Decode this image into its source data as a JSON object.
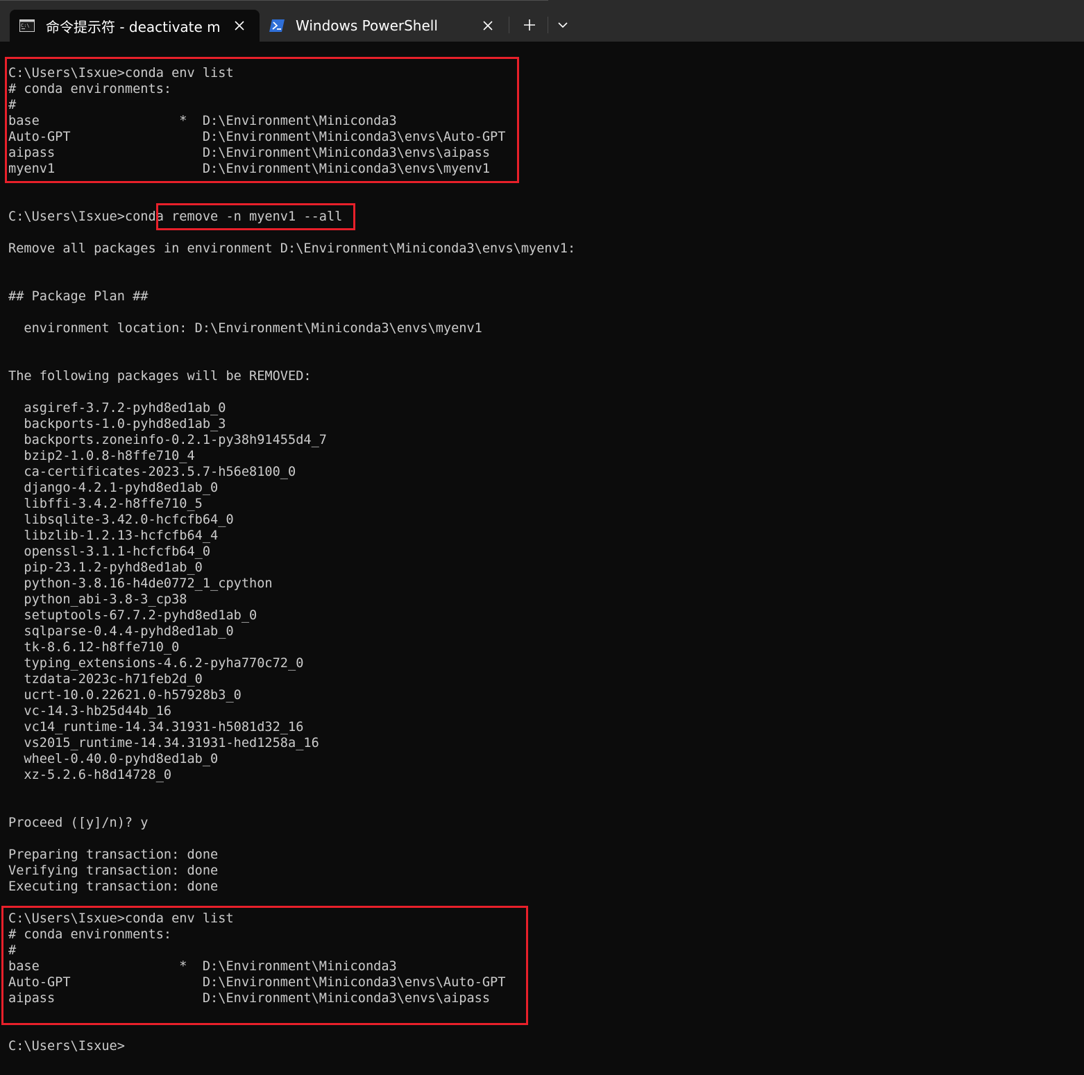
{
  "tabs": [
    {
      "label": "命令提示符 - deactivate  m",
      "icon": "cmd-icon",
      "active": true
    },
    {
      "label": "Windows PowerShell",
      "icon": "powershell-icon",
      "active": false
    }
  ],
  "tabbar": {
    "new_tab": "+",
    "dropdown": "chevron-down"
  },
  "terminal": {
    "lines": [
      "C:\\Users\\Isxue>conda env list",
      "# conda environments:",
      "#",
      "base                  *  D:\\Environment\\Miniconda3",
      "Auto-GPT                 D:\\Environment\\Miniconda3\\envs\\Auto-GPT",
      "aipass                   D:\\Environment\\Miniconda3\\envs\\aipass",
      "myenv1                   D:\\Environment\\Miniconda3\\envs\\myenv1",
      "",
      "",
      "C:\\Users\\Isxue>conda remove -n myenv1 --all",
      "",
      "Remove all packages in environment D:\\Environment\\Miniconda3\\envs\\myenv1:",
      "",
      "",
      "## Package Plan ##",
      "",
      "  environment location: D:\\Environment\\Miniconda3\\envs\\myenv1",
      "",
      "",
      "The following packages will be REMOVED:",
      "",
      "  asgiref-3.7.2-pyhd8ed1ab_0",
      "  backports-1.0-pyhd8ed1ab_3",
      "  backports.zoneinfo-0.2.1-py38h91455d4_7",
      "  bzip2-1.0.8-h8ffe710_4",
      "  ca-certificates-2023.5.7-h56e8100_0",
      "  django-4.2.1-pyhd8ed1ab_0",
      "  libffi-3.4.2-h8ffe710_5",
      "  libsqlite-3.42.0-hcfcfb64_0",
      "  libzlib-1.2.13-hcfcfb64_4",
      "  openssl-3.1.1-hcfcfb64_0",
      "  pip-23.1.2-pyhd8ed1ab_0",
      "  python-3.8.16-h4de0772_1_cpython",
      "  python_abi-3.8-3_cp38",
      "  setuptools-67.7.2-pyhd8ed1ab_0",
      "  sqlparse-0.4.4-pyhd8ed1ab_0",
      "  tk-8.6.12-h8ffe710_0",
      "  typing_extensions-4.6.2-pyha770c72_0",
      "  tzdata-2023c-h71feb2d_0",
      "  ucrt-10.0.22621.0-h57928b3_0",
      "  vc-14.3-hb25d44b_16",
      "  vc14_runtime-14.34.31931-h5081d32_16",
      "  vs2015_runtime-14.34.31931-hed1258a_16",
      "  wheel-0.40.0-pyhd8ed1ab_0",
      "  xz-5.2.6-h8d14728_0",
      "",
      "",
      "Proceed ([y]/n)? y",
      "",
      "Preparing transaction: done",
      "Verifying transaction: done",
      "Executing transaction: done",
      "",
      "C:\\Users\\Isxue>conda env list",
      "# conda environments:",
      "#",
      "base                  *  D:\\Environment\\Miniconda3",
      "Auto-GPT                 D:\\Environment\\Miniconda3\\envs\\Auto-GPT",
      "aipass                   D:\\Environment\\Miniconda3\\envs\\aipass",
      "",
      "",
      "C:\\Users\\Isxue>"
    ]
  },
  "colors": {
    "background": "#0c0c0c",
    "text": "#cccccc",
    "tabbar": "#2b2b2b",
    "highlight": "#e8202a"
  }
}
